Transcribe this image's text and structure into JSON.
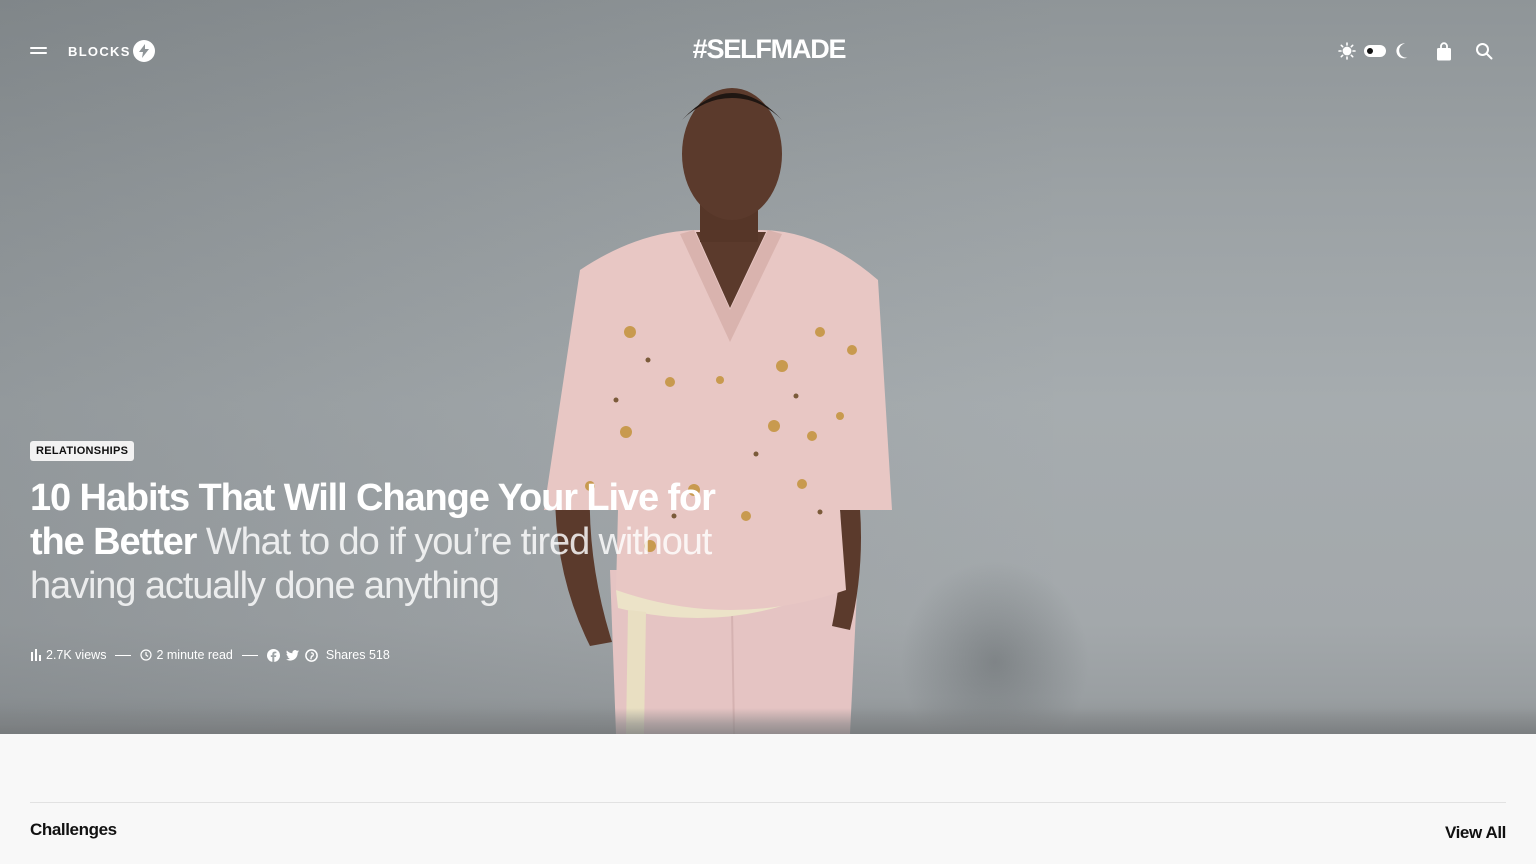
{
  "header": {
    "menu_icon": "hamburger-icon",
    "blocks_label": "BLOCKS",
    "blocks_icon": "lightning-bolt-icon",
    "logo": "#SELFMADE",
    "sun_icon": "sun-icon",
    "moon_icon": "moon-icon",
    "bag_icon": "shopping-bag-icon",
    "search_icon": "search-icon"
  },
  "hero": {
    "category": "RELATIONSHIPS",
    "title": "10 Habits That Will Change Your Live for the Better",
    "subtitle": "What to do if you’re tired without having actually done anything",
    "meta": {
      "views": "2.7K views",
      "views_icon": "bar-chart-icon",
      "read_time": "2 minute read",
      "read_icon": "clock-icon",
      "share_icons": [
        "facebook-icon",
        "twitter-icon",
        "pinterest-icon"
      ],
      "shares": "Shares 518"
    }
  },
  "section": {
    "title": "Challenges",
    "view_all": "View All"
  },
  "colors": {
    "hero_bg": "#a3a9ac",
    "page_bg": "#f8f8f8",
    "text_light": "#ffffff",
    "text_dark": "#111111",
    "shirt": "#e8c7c4"
  }
}
